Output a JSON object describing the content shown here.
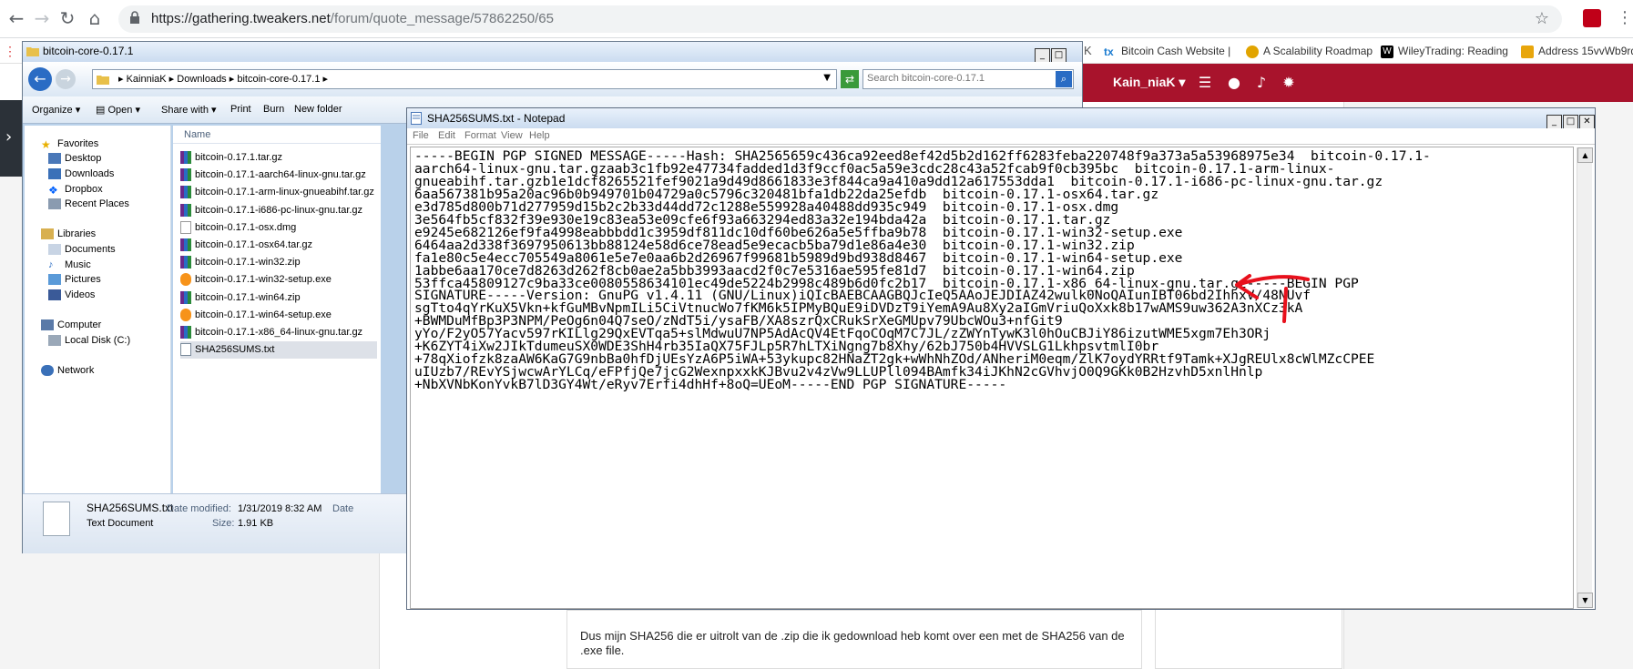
{
  "browser": {
    "url_host": "https://gathering.tweakers.net",
    "url_path": "/forum/quote_message/57862250/65",
    "bookmarks": [
      {
        "label": "Bitcoin Cash Website |",
        "color": "#1a7bd0"
      },
      {
        "label": "A Scalability Roadmap",
        "color": "#e1a400"
      },
      {
        "label": "WileyTrading: Reading",
        "color": "#000000"
      },
      {
        "label": "Address 15vvWb9rdJT",
        "color": "#e8a60c"
      }
    ]
  },
  "site": {
    "username": "Kain_niaK",
    "header_color": "#a8132c"
  },
  "explorer": {
    "title": "bitcoin-core-0.17.1",
    "breadcrumb": [
      "KainniaK",
      "Downloads",
      "bitcoin-core-0.17.1"
    ],
    "search_placeholder": "Search bitcoin-core-0.17.1",
    "toolbar": {
      "organize": "Organize",
      "open": "Open",
      "share_with": "Share with",
      "print": "Print",
      "burn": "Burn",
      "new_folder": "New folder"
    },
    "nav": {
      "favorites": "Favorites",
      "desktop": "Desktop",
      "downloads": "Downloads",
      "dropbox": "Dropbox",
      "recent_places": "Recent Places",
      "libraries": "Libraries",
      "documents": "Documents",
      "music": "Music",
      "pictures": "Pictures",
      "videos": "Videos",
      "computer": "Computer",
      "local_disk": "Local Disk (C:)",
      "network": "Network"
    },
    "column_name": "Name",
    "files": [
      {
        "name": "bitcoin-0.17.1.tar.gz",
        "type": "archive"
      },
      {
        "name": "bitcoin-0.17.1-aarch64-linux-gnu.tar.gz",
        "type": "archive"
      },
      {
        "name": "bitcoin-0.17.1-arm-linux-gnueabihf.tar.gz",
        "type": "archive"
      },
      {
        "name": "bitcoin-0.17.1-i686-pc-linux-gnu.tar.gz",
        "type": "archive"
      },
      {
        "name": "bitcoin-0.17.1-osx.dmg",
        "type": "blank"
      },
      {
        "name": "bitcoin-0.17.1-osx64.tar.gz",
        "type": "archive"
      },
      {
        "name": "bitcoin-0.17.1-win32.zip",
        "type": "archive"
      },
      {
        "name": "bitcoin-0.17.1-win32-setup.exe",
        "type": "bitcoin"
      },
      {
        "name": "bitcoin-0.17.1-win64.zip",
        "type": "archive"
      },
      {
        "name": "bitcoin-0.17.1-win64-setup.exe",
        "type": "bitcoin"
      },
      {
        "name": "bitcoin-0.17.1-x86_64-linux-gnu.tar.gz",
        "type": "archive"
      },
      {
        "name": "SHA256SUMS.txt",
        "type": "text"
      }
    ],
    "details": {
      "filename": "SHA256SUMS.txt",
      "date_modified_label": "Date modified:",
      "date_modified": "1/31/2019 8:32 AM",
      "date_label": "Date",
      "type": "Text Document",
      "size_label": "Size:",
      "size": "1.91 KB"
    }
  },
  "notepad": {
    "title": "SHA256SUMS.txt - Notepad",
    "menu": [
      "File",
      "Edit",
      "Format",
      "View",
      "Help"
    ],
    "lines": [
      "-----BEGIN PGP SIGNED MESSAGE-----Hash: SHA2565659c436ca92eed8ef42d5b2d162ff6283feba220748f9a373a5a53968975e34  bitcoin-0.17.1-",
      "aarch64-linux-gnu.tar.gzaab3c1fb92e47734fadded1d3f9ccf0ac5a59e3cdc28c43a52fcab9f0cb395bc  bitcoin-0.17.1-arm-linux-",
      "gnueabihf.tar.gzb1e1dcf8265521fef9021a9d49d8661833e3f844ca9a410a9dd12a617553dda1  bitcoin-0.17.1-i686-pc-linux-gnu.tar.gz",
      "6aa567381b95a20ac96b0b949701b04729a0c5796c320481bfa1db22da25efdb  bitcoin-0.17.1-osx64.tar.gz",
      "e3d785d800b71d277959d15b2c2b33d44dd72c1288e559928a40488dd935c949  bitcoin-0.17.1-osx.dmg",
      "3e564fb5cf832f39e930e19c83ea53e09cfe6f93a663294ed83a32e194bda42a  bitcoin-0.17.1.tar.gz",
      "e9245e682126ef9fa4998eabbbdd1c3959df811dc10df60be626a5e5ffba9b78  bitcoin-0.17.1-win32-setup.exe",
      "6464aa2d338f3697950613bb88124e58d6ce78ead5e9ecacb5ba79d1e86a4e30  bitcoin-0.17.1-win32.zip",
      "fa1e80c5e4ecc705549a8061e5e7e0aa6b2d26967f99681b5989d9bd938d8467  bitcoin-0.17.1-win64-setup.exe",
      "1abbe6aa170ce7d8263d262f8cb0ae2a5bb3993aacd2f0c7e5316ae595fe81d7  bitcoin-0.17.1-win64.zip",
      "53ffca45809127c9ba33ce0080558634101ec49de5224b2998c489b6d0fc2b17  bitcoin-0.17.1-x86_64-linux-gnu.tar.gz-----BEGIN PGP",
      "SIGNATURE-----Version: GnuPG v1.4.11 (GNU/Linux)iQIcBAEBCAAGBQJcIeQ5AAoJEJDIAZ42wulk0NoQAIunIBT06bd2IhhxV/48NUvf",
      "sgTto4qYrKuX5Vkn+kfGuMBvNpmILi5CiVtnucWo7fKM6k5IPMyBQuE9iDVDzT9iYemA9Au8Xy2aIGmVriuQoXxk8b17wAMS9uw362A3nXCz3kA",
      "+BWMDuMfBp3P3NPM/PeOg6n04Q7seO/zNdT5i/ysaFB/XA8szrQxCRukSrXeGMUpv79UbcWOu3+nfGit9",
      "yYo/F2yO57Yacv597rKILlg29QxEVTqa5+slMdwuU7NP5AdAcQV4EtFqoCOqM7C7JL/zZWYnTywK3l0hOuCBJiY86izutWME5xgm7Eh3ORj",
      "+K6ZYT4iXw2JIkTdumeuSX0WDE3ShH4rb35IaQX75FJLp5R7hLTXiNgng7b8Xhy/62bJ750b4HVVSLG1LkhpsvtmlI0br",
      "+78qXiofzk8zaAW6KaG7G9nbBa0hfDjUEsYzA6P5iWA+53ykupc82HNaZT2gk+wWhNhZOd/ANheriM0eqm/ZlK7oydYRRtf9Tamk+XJgREUlx8cWlMZcCPEE",
      "uIUzb7/REvYSjwcwArYLCq/eFPfjQe7jcG2WexnpxxkKJBvu2v4zVw9LLUPll094BAmfk34iJKhN2cGVhvjO0Q9GKk0B2HzvhD5xnlHnlp",
      "+NbXVNbKonYvkB7lD3GY4Wt/eRyv7Erfi4dhHf+8oQ=UEoM-----END PGP SIGNATURE-----"
    ]
  },
  "post": {
    "text": "Dus mijn SHA256 die er uitrolt van de .zip die ik gedownload heb komt over een met de SHA256 van de .exe file."
  },
  "annotation": {
    "color": "#e8101c"
  }
}
